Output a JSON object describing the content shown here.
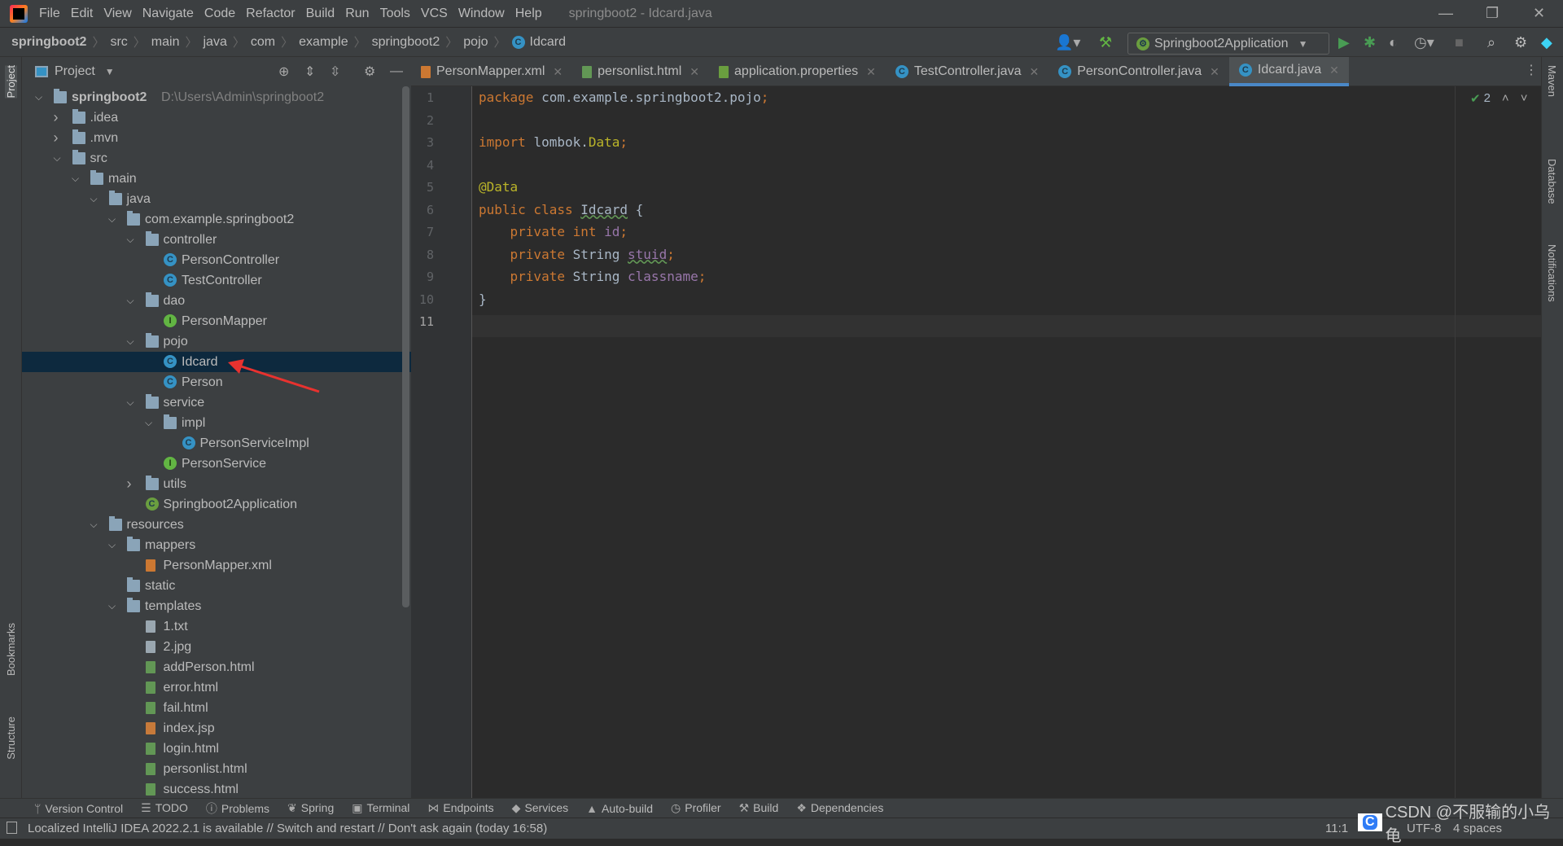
{
  "app": {
    "title": "springboot2 - Idcard.java",
    "menu": [
      "File",
      "Edit",
      "View",
      "Navigate",
      "Code",
      "Refactor",
      "Build",
      "Run",
      "Tools",
      "VCS",
      "Window",
      "Help"
    ]
  },
  "breadcrumb": [
    "springboot2",
    "src",
    "main",
    "java",
    "com",
    "example",
    "springboot2",
    "pojo",
    "Idcard"
  ],
  "toolbar": {
    "run_config": "Springboot2Application"
  },
  "project": {
    "title": "Project",
    "tree": [
      {
        "label": "springboot2",
        "hint": "D:\\Users\\Admin\\springboot2",
        "depth": 0,
        "type": "folder",
        "exp": "open"
      },
      {
        "label": ".idea",
        "depth": 1,
        "type": "folder",
        "exp": "closed"
      },
      {
        "label": ".mvn",
        "depth": 1,
        "type": "folder",
        "exp": "closed"
      },
      {
        "label": "src",
        "depth": 1,
        "type": "folder",
        "exp": "open"
      },
      {
        "label": "main",
        "depth": 2,
        "type": "folder",
        "exp": "open"
      },
      {
        "label": "java",
        "depth": 3,
        "type": "folder",
        "exp": "open"
      },
      {
        "label": "com.example.springboot2",
        "depth": 4,
        "type": "folder",
        "exp": "open"
      },
      {
        "label": "controller",
        "depth": 5,
        "type": "folder",
        "exp": "open"
      },
      {
        "label": "PersonController",
        "depth": 6,
        "type": "class"
      },
      {
        "label": "TestController",
        "depth": 6,
        "type": "class"
      },
      {
        "label": "dao",
        "depth": 5,
        "type": "folder",
        "exp": "open"
      },
      {
        "label": "PersonMapper",
        "depth": 6,
        "type": "interface"
      },
      {
        "label": "pojo",
        "depth": 5,
        "type": "folder",
        "exp": "open"
      },
      {
        "label": "Idcard",
        "depth": 6,
        "type": "class",
        "selected": true
      },
      {
        "label": "Person",
        "depth": 6,
        "type": "class"
      },
      {
        "label": "service",
        "depth": 5,
        "type": "folder",
        "exp": "open"
      },
      {
        "label": "impl",
        "depth": 6,
        "type": "folder",
        "exp": "open"
      },
      {
        "label": "PersonServiceImpl",
        "depth": 7,
        "type": "class"
      },
      {
        "label": "PersonService",
        "depth": 6,
        "type": "interface"
      },
      {
        "label": "utils",
        "depth": 5,
        "type": "folder",
        "exp": "closed"
      },
      {
        "label": "Springboot2Application",
        "depth": 5,
        "type": "spring"
      },
      {
        "label": "resources",
        "depth": 3,
        "type": "folder",
        "exp": "open"
      },
      {
        "label": "mappers",
        "depth": 4,
        "type": "folder",
        "exp": "open"
      },
      {
        "label": "PersonMapper.xml",
        "depth": 5,
        "type": "xml"
      },
      {
        "label": "static",
        "depth": 4,
        "type": "folder"
      },
      {
        "label": "templates",
        "depth": 4,
        "type": "folder",
        "exp": "open"
      },
      {
        "label": "1.txt",
        "depth": 5,
        "type": "txt"
      },
      {
        "label": "2.jpg",
        "depth": 5,
        "type": "txt"
      },
      {
        "label": "addPerson.html",
        "depth": 5,
        "type": "html"
      },
      {
        "label": "error.html",
        "depth": 5,
        "type": "html"
      },
      {
        "label": "fail.html",
        "depth": 5,
        "type": "html"
      },
      {
        "label": "index.jsp",
        "depth": 5,
        "type": "jsp"
      },
      {
        "label": "login.html",
        "depth": 5,
        "type": "html"
      },
      {
        "label": "personlist.html",
        "depth": 5,
        "type": "html"
      },
      {
        "label": "success.html",
        "depth": 5,
        "type": "html"
      }
    ]
  },
  "tabs": [
    {
      "label": "PersonMapper.xml",
      "icon": "xml-file-icon"
    },
    {
      "label": "personlist.html",
      "icon": "html-file-icon"
    },
    {
      "label": "application.properties",
      "icon": "spring-properties-icon"
    },
    {
      "label": "TestController.java",
      "icon": "class-icon"
    },
    {
      "label": "PersonController.java",
      "icon": "class-icon"
    },
    {
      "label": "Idcard.java",
      "icon": "class-icon",
      "active": true
    }
  ],
  "editor": {
    "inspection_count": "2",
    "current_line": 11,
    "lines": [
      [
        [
          "kw",
          "package "
        ],
        [
          "",
          "com.example.springboot2.pojo"
        ],
        [
          "kw",
          ";"
        ]
      ],
      [],
      [
        [
          "kw",
          "import "
        ],
        [
          "",
          "lombok."
        ],
        [
          "an",
          "Data"
        ],
        [
          "kw",
          ";"
        ]
      ],
      [],
      [
        [
          "an",
          "@Data"
        ]
      ],
      [
        [
          "kw",
          "public class "
        ],
        [
          "wv",
          "Idcard"
        ],
        [
          "",
          " {"
        ]
      ],
      [
        [
          "",
          "    "
        ],
        [
          "kw",
          "private int "
        ],
        [
          "fd",
          "id"
        ],
        [
          "kw",
          ";"
        ]
      ],
      [
        [
          "",
          "    "
        ],
        [
          "kw",
          "private "
        ],
        [
          "",
          "String "
        ],
        [
          "fd wv",
          "stuid"
        ],
        [
          "kw",
          ";"
        ]
      ],
      [
        [
          "",
          "    "
        ],
        [
          "kw",
          "private "
        ],
        [
          "",
          "String "
        ],
        [
          "fd",
          "classname"
        ],
        [
          "kw",
          ";"
        ]
      ],
      [
        [
          "",
          "}"
        ]
      ],
      []
    ]
  },
  "left_stripe": [
    "Project",
    "Bookmarks",
    "Structure"
  ],
  "right_stripe": [
    "Maven",
    "Database",
    "Notifications"
  ],
  "bottom_tools": [
    "Version Control",
    "TODO",
    "Problems",
    "Spring",
    "Terminal",
    "Endpoints",
    "Services",
    "Auto-build",
    "Profiler",
    "Build",
    "Dependencies"
  ],
  "status": {
    "message": "Localized IntelliJ IDEA 2022.2.1 is available // Switch and restart // Don't ask again (today 16:58)",
    "position": "11:1",
    "encoding": "UTF-8",
    "indent": "4 spaces"
  },
  "watermark": "CSDN @不服输的小乌龟",
  "colors": {
    "accent": "#4a88c7",
    "selection": "#0d293e",
    "annotation_arrow": "#e8322f"
  }
}
